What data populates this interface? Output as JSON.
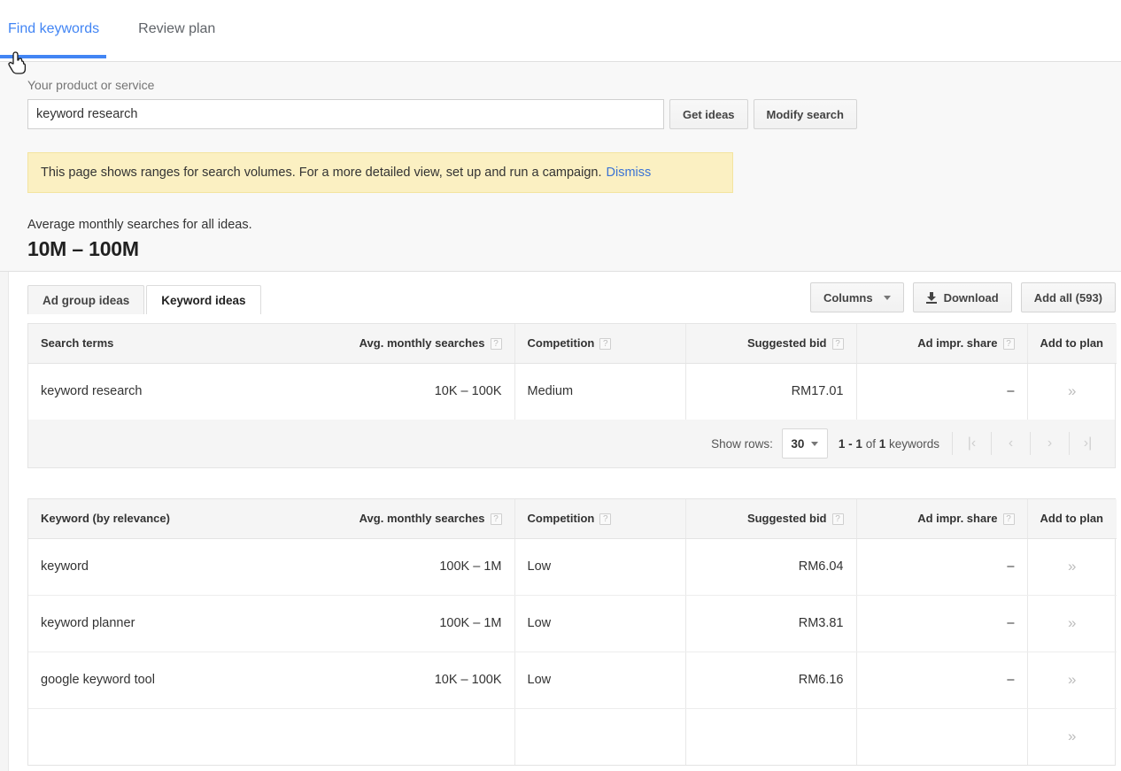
{
  "top_tabs": [
    {
      "label": "Find keywords",
      "active": true
    },
    {
      "label": "Review plan",
      "active": false
    }
  ],
  "search": {
    "label": "Your product or service",
    "value": "keyword research",
    "placeholder": "Your product or service",
    "get_ideas_label": "Get ideas",
    "modify_label": "Modify search"
  },
  "notice": {
    "text": "This page shows ranges for search volumes. For a more detailed view, set up and run a campaign.",
    "dismiss_label": "Dismiss"
  },
  "summary": {
    "label": "Average monthly searches for all ideas.",
    "value": "10M – 100M"
  },
  "idea_tabs": [
    {
      "label": "Ad group ideas",
      "active": false
    },
    {
      "label": "Keyword ideas",
      "active": true
    }
  ],
  "toolbar": {
    "columns_label": "Columns",
    "download_label": "Download",
    "add_all_label": "Add all (593)"
  },
  "search_terms_table": {
    "headers": {
      "term": "Search terms",
      "volume": "Avg. monthly searches",
      "competition": "Competition",
      "bid": "Suggested bid",
      "share": "Ad impr. share",
      "plan": "Add to plan"
    },
    "help_glyph": "?",
    "add_glyph": "»",
    "rows": [
      {
        "term": "keyword research",
        "volume": "10K – 100K",
        "competition": "Medium",
        "bid": "RM17.01",
        "share": "–"
      }
    ]
  },
  "pagination": {
    "show_rows_label": "Show rows:",
    "rows_value": "30",
    "range_prefix": "1 - 1",
    "range_mid": " of ",
    "range_count": "1",
    "range_suffix": " keywords",
    "first_glyph": "|‹",
    "prev_glyph": "‹",
    "next_glyph": "›",
    "last_glyph": "›|"
  },
  "keyword_table": {
    "headers": {
      "term": "Keyword (by relevance)",
      "volume": "Avg. monthly searches",
      "competition": "Competition",
      "bid": "Suggested bid",
      "share": "Ad impr. share",
      "plan": "Add to plan"
    },
    "help_glyph": "?",
    "add_glyph": "»",
    "rows": [
      {
        "term": "keyword",
        "volume": "100K – 1M",
        "competition": "Low",
        "bid": "RM6.04",
        "share": "–"
      },
      {
        "term": "keyword planner",
        "volume": "100K – 1M",
        "competition": "Low",
        "bid": "RM3.81",
        "share": "–"
      },
      {
        "term": "google keyword tool",
        "volume": "10K – 100K",
        "competition": "Low",
        "bid": "RM6.16",
        "share": "–"
      },
      {
        "term": "",
        "volume": "",
        "competition": "",
        "bid": "",
        "share": ""
      }
    ]
  },
  "colors": {
    "accent": "#4285f4",
    "notice_bg": "#fbf0c2",
    "link": "#3b73d4"
  }
}
